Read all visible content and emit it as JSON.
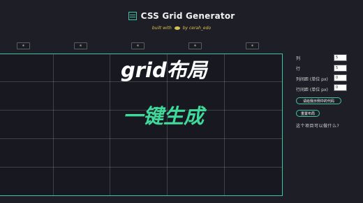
{
  "header": {
    "title": "CSS Grid Generator",
    "subtitle_before": "built with",
    "subtitle_after": "by cerah_edo"
  },
  "column_inputs": [
    {
      "icon": "star-icon",
      "value": "★"
    },
    {
      "icon": "star-icon",
      "value": "★"
    },
    {
      "icon": "star-icon",
      "value": "★"
    },
    {
      "icon": "star-icon",
      "value": "★"
    },
    {
      "icon": "star-icon",
      "value": "★"
    }
  ],
  "overlay": {
    "line1": "grid布局",
    "line2": "一键生成"
  },
  "controls": {
    "columns_label": "列",
    "columns_value": "5",
    "rows_label": "行",
    "rows_value": "5",
    "col_gap_label": "列间距 (单位 px)",
    "col_gap_value": "0",
    "row_gap_label": "行间距 (单位 px)",
    "row_gap_value": "0",
    "get_code_button": "请给我示例中的代码",
    "reset_button": "重置布局",
    "question": "这个项目可以做什么?"
  },
  "colors": {
    "accent": "#3ec7a6",
    "background": "#1e1f26",
    "overlay_green": "#3fd99b",
    "subtitle_yellow": "#d8c24f"
  }
}
